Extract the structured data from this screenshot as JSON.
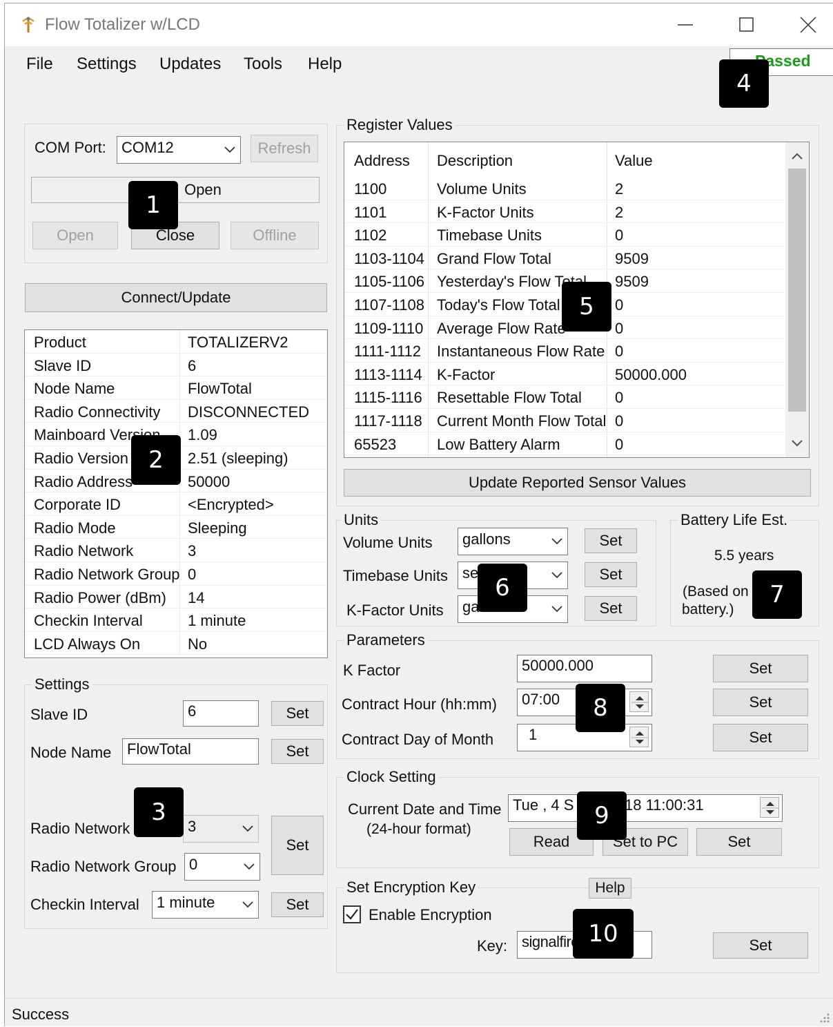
{
  "window": {
    "title": "Flow Totalizer w/LCD"
  },
  "menu": {
    "items": [
      "File",
      "Settings",
      "Updates",
      "Tools",
      "Help"
    ]
  },
  "status_indicator": "Passed",
  "connection": {
    "com_port_label": "COM Port:",
    "com_port_value": "COM12",
    "refresh_label": "Refresh",
    "open_wide_label": "Open",
    "open_label": "Open",
    "close_label": "Close",
    "offline_label": "Offline"
  },
  "connect_update_label": "Connect/Update",
  "device_info": [
    {
      "key": "Product",
      "value": "TOTALIZERV2"
    },
    {
      "key": "Slave ID",
      "value": "6"
    },
    {
      "key": "Node Name",
      "value": "FlowTotal"
    },
    {
      "key": "Radio Connectivity",
      "value": "DISCONNECTED"
    },
    {
      "key": "Mainboard Version",
      "value": "1.09"
    },
    {
      "key": "Radio Version",
      "value": "2.51 (sleeping)"
    },
    {
      "key": "Radio Address",
      "value": "50000"
    },
    {
      "key": "Corporate ID",
      "value": "<Encrypted>"
    },
    {
      "key": "Radio Mode",
      "value": "Sleeping"
    },
    {
      "key": "Radio Network",
      "value": "3"
    },
    {
      "key": "Radio Network Group",
      "value": "0"
    },
    {
      "key": "Radio Power (dBm)",
      "value": "14"
    },
    {
      "key": "Checkin Interval",
      "value": "1 minute"
    },
    {
      "key": "LCD Always On",
      "value": "No"
    }
  ],
  "settings": {
    "title": "Settings",
    "slave_id_label": "Slave ID",
    "slave_id_value": "6",
    "node_name_label": "Node Name",
    "node_name_value": "FlowTotal",
    "radio_network_label": "Radio Network",
    "radio_network_value": "3",
    "radio_network_group_label": "Radio Network Group",
    "radio_network_group_value": "0",
    "checkin_interval_label": "Checkin Interval",
    "checkin_interval_value": "1 minute",
    "set_label": "Set"
  },
  "registers": {
    "title": "Register Values",
    "columns": [
      "Address",
      "Description",
      "Value"
    ],
    "rows": [
      {
        "address": "1100",
        "description": "Volume Units",
        "value": "2"
      },
      {
        "address": "1101",
        "description": "K-Factor Units",
        "value": "2"
      },
      {
        "address": "1102",
        "description": "Timebase Units",
        "value": "0"
      },
      {
        "address": "1103-1104",
        "description": "Grand Flow Total",
        "value": "9509"
      },
      {
        "address": "1105-1106",
        "description": "Yesterday's Flow Total",
        "value": "9509"
      },
      {
        "address": "1107-1108",
        "description": "Today's Flow Total",
        "value": "0"
      },
      {
        "address": "1109-1110",
        "description": "Average Flow Rate",
        "value": "0"
      },
      {
        "address": "1111-1112",
        "description": "Instantaneous Flow Rate",
        "value": "0"
      },
      {
        "address": "1113-1114",
        "description": "K-Factor",
        "value": "50000.000"
      },
      {
        "address": "1115-1116",
        "description": "Resettable Flow Total",
        "value": "0"
      },
      {
        "address": "1117-1118",
        "description": "Current Month Flow Total",
        "value": "0"
      },
      {
        "address": "65523",
        "description": "Low Battery Alarm",
        "value": "0"
      }
    ],
    "update_button_label": "Update Reported Sensor Values"
  },
  "units": {
    "title": "Units",
    "volume_label": "Volume Units",
    "volume_value": "gallons",
    "timebase_label": "Timebase Units",
    "timebase_value": "se",
    "kfactor_label": "K-Factor Units",
    "kfactor_value": "ga",
    "set_label": "Set"
  },
  "battery": {
    "title": "Battery Life Est.",
    "value": "5.5 years",
    "note_line1": "(Based on",
    "note_line2": "battery.)"
  },
  "parameters": {
    "title": "Parameters",
    "kfactor_label": "K Factor",
    "kfactor_value": "50000.000",
    "contract_hour_label": "Contract Hour (hh:mm)",
    "contract_hour_value": "07:00",
    "contract_day_label": "Contract Day of Month",
    "contract_day_value": "1",
    "set_label": "Set"
  },
  "clock": {
    "title": "Clock Setting",
    "label_line1": "Current Date and Time",
    "label_line2": "(24-hour format)",
    "datetime_part1": "Tue ,   4  S",
    "datetime_part2": "18   11:00:31",
    "read_label": "Read",
    "set_to_pc_label": "Set to PC",
    "set_label": "Set"
  },
  "encryption": {
    "title": "Set Encryption Key",
    "help_label": "Help",
    "enable_label": "Enable Encryption",
    "enabled": true,
    "key_label": "Key:",
    "key_value": "signalfire",
    "set_label": "Set"
  },
  "statusbar": {
    "text": "Success"
  },
  "badges": [
    "1",
    "2",
    "3",
    "4",
    "5",
    "6",
    "7",
    "8",
    "9",
    "10"
  ],
  "colors": {
    "passed": "#1a9c1a",
    "window_bg": "#f0f0f0",
    "focus": "#0078d7"
  }
}
